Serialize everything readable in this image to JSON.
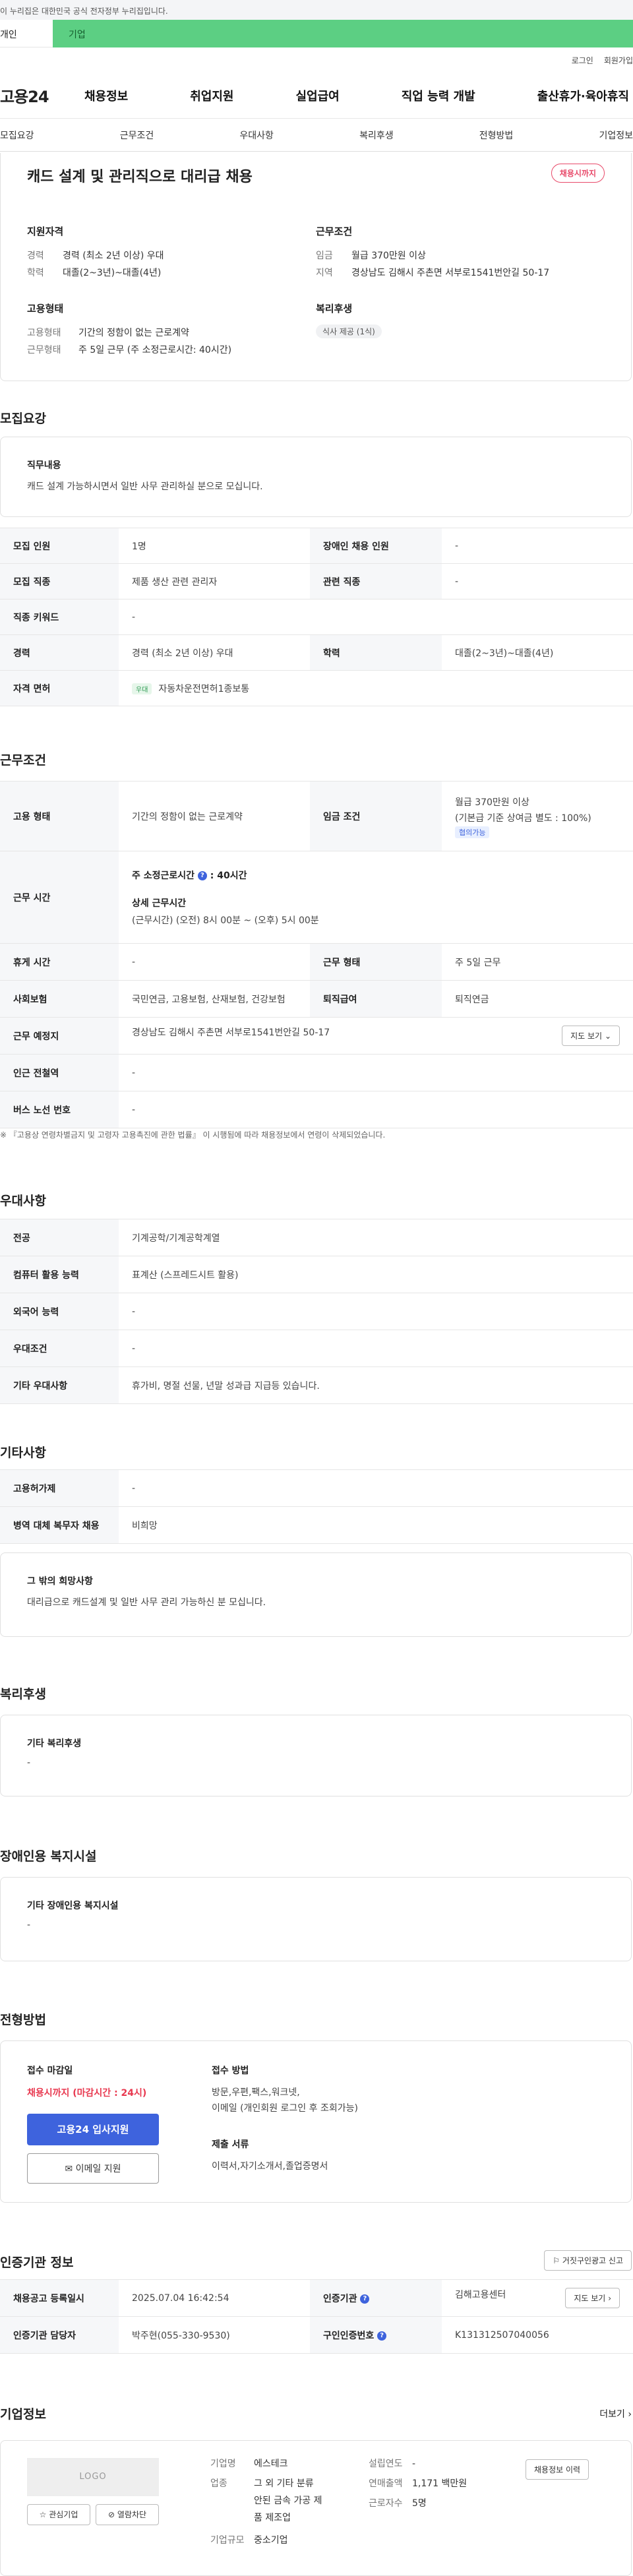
{
  "gov_notice": "이 누리집은 대한민국 공식 전자정부 누리집입니다.",
  "user_tabs": [
    "개인",
    "기업"
  ],
  "util_links": [
    "로그인",
    "회원가입"
  ],
  "logo": "고용24",
  "gnb": [
    "채용정보",
    "취업지원",
    "실업급여",
    "직업 능력 개발",
    "출산휴가·육아휴직"
  ],
  "subnav": [
    "모집요강",
    "근무조건",
    "우대사항",
    "복리후생",
    "전형방법",
    "기업정보"
  ],
  "summary": {
    "title": "캐드 설계 및 관리직으로 대리급 채용",
    "badge": "채용시까지",
    "qualification_title": "지원자격",
    "qualification": [
      [
        "경력",
        "경력 (최소 2년 이상) 우대"
      ],
      [
        "학력",
        "대졸(2~3년)~대졸(4년)"
      ]
    ],
    "employment_title": "고용형태",
    "employment": [
      [
        "고용형태",
        "기간의 정함이 없는 근로계약"
      ],
      [
        "근무형태",
        "주 5일 근무 (주 소정근로시간: 40시간)"
      ]
    ],
    "work_title": "근무조건",
    "work": [
      [
        "임금",
        "월급 370만원 이상"
      ],
      [
        "지역",
        "경상남도 김해시 주촌면 서부로1541번안길 50-17"
      ]
    ],
    "welfare_title": "복리후생",
    "welfare_chip": "식사 제공 (1식)"
  },
  "recruit": {
    "title": "모집요강",
    "duty_label": "직무내용",
    "duty": "캐드 설계 가능하시면서 일반 사무 관리하실 분으로 모십니다.",
    "rows": {
      "count_k": "모집 인원",
      "count_v": "1명",
      "disabled_k": "장애인 채용 인원",
      "disabled_v": "-",
      "job_k": "모집 직종",
      "job_v": "제품 생산 관련 관리자",
      "rel_k": "관련 직종",
      "rel_v": "-",
      "kw_k": "직종 키워드",
      "kw_v": "-",
      "career_k": "경력",
      "career_v": "경력 (최소 2년 이상) 우대",
      "edu_k": "학력",
      "edu_v": "대졸(2~3년)~대졸(4년)",
      "license_k": "자격 면허",
      "license_tag": "우대",
      "license_v": "자동차운전면허1종보통"
    }
  },
  "conditions": {
    "title": "근무조건",
    "emp_k": "고용 형태",
    "emp_v": "기간의 정함이 없는 근로계약",
    "wage_k": "임금 조건",
    "wage_v1": "월급 370만원 이상",
    "wage_v2": "(기본급 기준 상여금 별도 : 100%)",
    "wage_tag": "협의가능",
    "time_k": "근무 시간",
    "time_main_label": "주 소정근로시간",
    "time_main_value": ": 40시간",
    "time_detail_label": "상세 근무시간",
    "time_detail": "(근무시간) (오전) 8시 00분 ~ (오후) 5시 00분",
    "rest_k": "휴게 시간",
    "rest_v": "-",
    "form_k": "근무 형태",
    "form_v": "주 5일 근무",
    "ins_k": "사회보험",
    "ins_v": "국민연금, 고용보험, 산재보험, 건강보험",
    "ret_k": "퇴직급여",
    "ret_v": "퇴직연금",
    "place_k": "근무 예정지",
    "place_v": "경상남도 김해시 주촌면 서부로1541번안길 50-17",
    "map_btn": "지도 보기",
    "sub_k": "인근 전철역",
    "sub_v": "-",
    "bus_k": "버스 노선 번호",
    "bus_v": "-",
    "note": "※ 『고용상 연령차별금지 및 고령자 고용촉진에 관한 법률』 이 시행됨에 따라 채용정보에서 연령이 삭제되었습니다."
  },
  "preference": {
    "title": "우대사항",
    "major_k": "전공",
    "major_v": "기계공학/기계공학계열",
    "pc_k": "컴퓨터 활용 능력",
    "pc_v": "표계산 (스프레드시트 활용)",
    "lang_k": "외국어 능력",
    "lang_v": "-",
    "pref_k": "우대조건",
    "pref_v": "-",
    "etc_k": "기타 우대사항",
    "etc_v": "휴가비, 명절 선물, 년말 성과급 지급등 있습니다."
  },
  "etc": {
    "title": "기타사항",
    "hire_k": "고용허가제",
    "hire_v": "-",
    "mil_k": "병역 대체 복무자 채용",
    "mil_v": "비희망",
    "wish_label": "그 밖의 희망사항",
    "wish": "대리급으로 캐드설계 및 일반 사무 관리 가능하신 분 모십니다."
  },
  "welfare": {
    "title": "복리후생",
    "label": "기타 복리후생",
    "value": "-"
  },
  "disability": {
    "title": "장애인용 복지시설",
    "label": "기타 장애인용 복지시설",
    "value": "-"
  },
  "process": {
    "title": "전형방법",
    "deadline_label": "접수 마감일",
    "deadline": "채용시까지 (마감시간 : 24시)",
    "apply_btn": "고용24 입사지원",
    "email_btn": "이메일 지원",
    "method_label": "접수 방법",
    "method_1": "방문,우편,팩스,워크넷,",
    "method_2": "이메일 (개인회원 로그인 후 조회가능)",
    "docs_label": "제출 서류",
    "docs": "이력서,자기소개서,졸업증명서"
  },
  "agency": {
    "title": "인증기관 정보",
    "report_btn": "거짓구인광고 신고",
    "reg_k": "채용공고 등록일시",
    "reg_v": "2025.07.04 16:42:54",
    "org_k": "인증기관",
    "org_v": "김해고용센터",
    "map_btn": "지도 보기",
    "mgr_k": "인증기관 담당자",
    "mgr_v": "박주현(055-330-9530)",
    "num_k": "구인인증번호",
    "num_v": "K131312507040056"
  },
  "company": {
    "title": "기업정보",
    "more": "더보기",
    "logo": "LOGO",
    "fav_btn": "관심기업",
    "block_btn": "열람차단",
    "name_k": "기업명",
    "name_v": "에스테크",
    "ind_k": "업종",
    "ind_v1": "그 외 기타 분류",
    "ind_v2": "안된 금속 가공 제",
    "ind_v3": "품 제조업",
    "size_k": "기업규모",
    "size_v": "중소기업",
    "year_k": "설립연도",
    "year_v": "-",
    "sales_k": "연매출액",
    "sales_v": "1,171 백만원",
    "emp_k": "근로자수",
    "emp_v": "5명",
    "jobs_btn": "채용정보 이력"
  }
}
